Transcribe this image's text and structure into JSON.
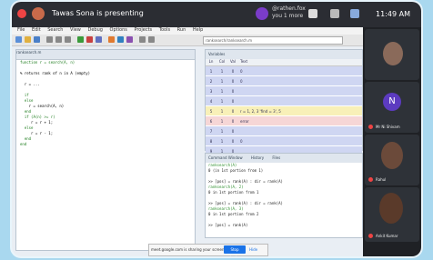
{
  "meet": {
    "presenting": "Tawas Sona is presenting",
    "sender_line1": "@rathen.fox",
    "sender_line2": "you 1 more",
    "time": "11:49 AM"
  },
  "ide": {
    "menu": [
      "File",
      "Edit",
      "Search",
      "View",
      "Debug",
      "Options",
      "Projects",
      "Tools",
      "Run",
      "Help"
    ],
    "address": "ranksearch/ranksearch.m",
    "editor_tab": "ranksearch.m",
    "editor_lines": [
      "function r = search(A, n)",
      "",
      "% returns rank of n in A (empty)",
      "",
      "  r = ...",
      "",
      "  if",
      "  else",
      "    r = search(A, n)",
      "  end",
      "  if (A(n) >= r)",
      "     r = r + 1;",
      "  else",
      "     r = r - 1;",
      "  end",
      "end"
    ],
    "panel_title": "Variables",
    "columns": [
      "Ln",
      "Col",
      "Val",
      "Text"
    ],
    "rows": [
      {
        "ln": "1",
        "col": "1",
        "val": "0",
        "text": "0",
        "hl": "blue"
      },
      {
        "ln": "2",
        "col": "1",
        "val": "0",
        "text": "0",
        "hl": "blue"
      },
      {
        "ln": "3",
        "col": "1",
        "val": "0",
        "text": "",
        "hl": "blue"
      },
      {
        "ln": "4",
        "col": "1",
        "val": "0",
        "text": "",
        "hl": "blue"
      },
      {
        "ln": "5",
        "col": "1",
        "val": "0",
        "text": "r = 1, 2, 3   'find = 3', 5",
        "hl": "yellow"
      },
      {
        "ln": "6",
        "col": "1",
        "val": "0",
        "text": "error",
        "hl": "pink"
      },
      {
        "ln": "7",
        "col": "1",
        "val": "0",
        "text": "",
        "hl": "blue"
      },
      {
        "ln": "8",
        "col": "1",
        "val": "0",
        "text": "0",
        "hl": "blue"
      },
      {
        "ln": "9",
        "col": "1",
        "val": "0",
        "text": "",
        "hl": "blue"
      }
    ],
    "console_tabs": [
      "Command Window",
      "History",
      "Files"
    ],
    "console_lines": [
      {
        "t": "ranksearch(A)",
        "c": "g"
      },
      {
        "t": "0 (in 1st portion from 1)",
        "c": "n"
      },
      {
        "t": "",
        "c": "n"
      },
      {
        "t": ">> [pos] = rank(A) : dir = rank(A)",
        "c": "n"
      },
      {
        "t": "ranksearch(A, 2)",
        "c": "g"
      },
      {
        "t": "0 in 1st portion from 1",
        "c": "n"
      },
      {
        "t": "",
        "c": "n"
      },
      {
        "t": ">> [pos] = rank(A) : dir = rank(A)",
        "c": "n"
      },
      {
        "t": "ranksearch(A, 3)",
        "c": "g"
      },
      {
        "t": "0 in 1st portion from 2",
        "c": "n"
      },
      {
        "t": "",
        "c": "n"
      },
      {
        "t": ">> [pos] = rank(A)",
        "c": "n"
      }
    ]
  },
  "sharebar": {
    "message": "meet.google.com is sharing your screen",
    "stop": "Stop sharing",
    "hide": "Hide"
  },
  "participants": [
    {
      "name": "",
      "kind": "video"
    },
    {
      "name": "Mr Ni Shivam",
      "kind": "letter",
      "letter": "N"
    },
    {
      "name": "Rahul",
      "kind": "video"
    },
    {
      "name": "Ankit Kumar",
      "kind": "video"
    }
  ],
  "colors": {
    "accent": "#1a73e8",
    "highlight_blue": "#cfd6f2",
    "highlight_yellow": "#f8f0b8",
    "highlight_pink": "#f6d6d6"
  }
}
